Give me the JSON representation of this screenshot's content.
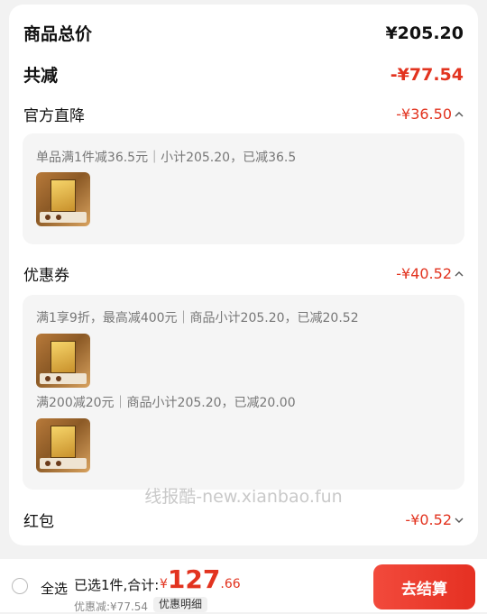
{
  "summary": {
    "total_label": "商品总价",
    "total_value": "¥205.20",
    "reduce_label": "共减",
    "reduce_value": "-¥77.54"
  },
  "official": {
    "label": "官方直降",
    "value": "-¥36.50",
    "detail": "单品满1件减36.5元｜小计205.20，已减36.5"
  },
  "coupon": {
    "label": "优惠券",
    "value": "-¥40.52",
    "detail1": "满1享9折，最高减400元｜商品小计205.20，已减20.52",
    "detail2": "满200减20元｜商品小计205.20，已减20.00"
  },
  "redpacket": {
    "label": "红包",
    "value": "-¥0.52"
  },
  "watermark": "线报酷-new.xianbao.fun",
  "footer": {
    "select_all": "全选",
    "selected_total": "已选1件,合计:",
    "price_currency": "¥",
    "price_int": "127",
    "price_dec": ".66",
    "discount_text": "优惠减:¥77.54",
    "detail_button": "优惠明细",
    "checkout_button": "去结算"
  },
  "colors": {
    "accent": "#e2331f"
  },
  "icons": {
    "collapse": "chevron-up-icon",
    "expand": "chevron-down-icon",
    "radio": "radio-unchecked-icon"
  }
}
